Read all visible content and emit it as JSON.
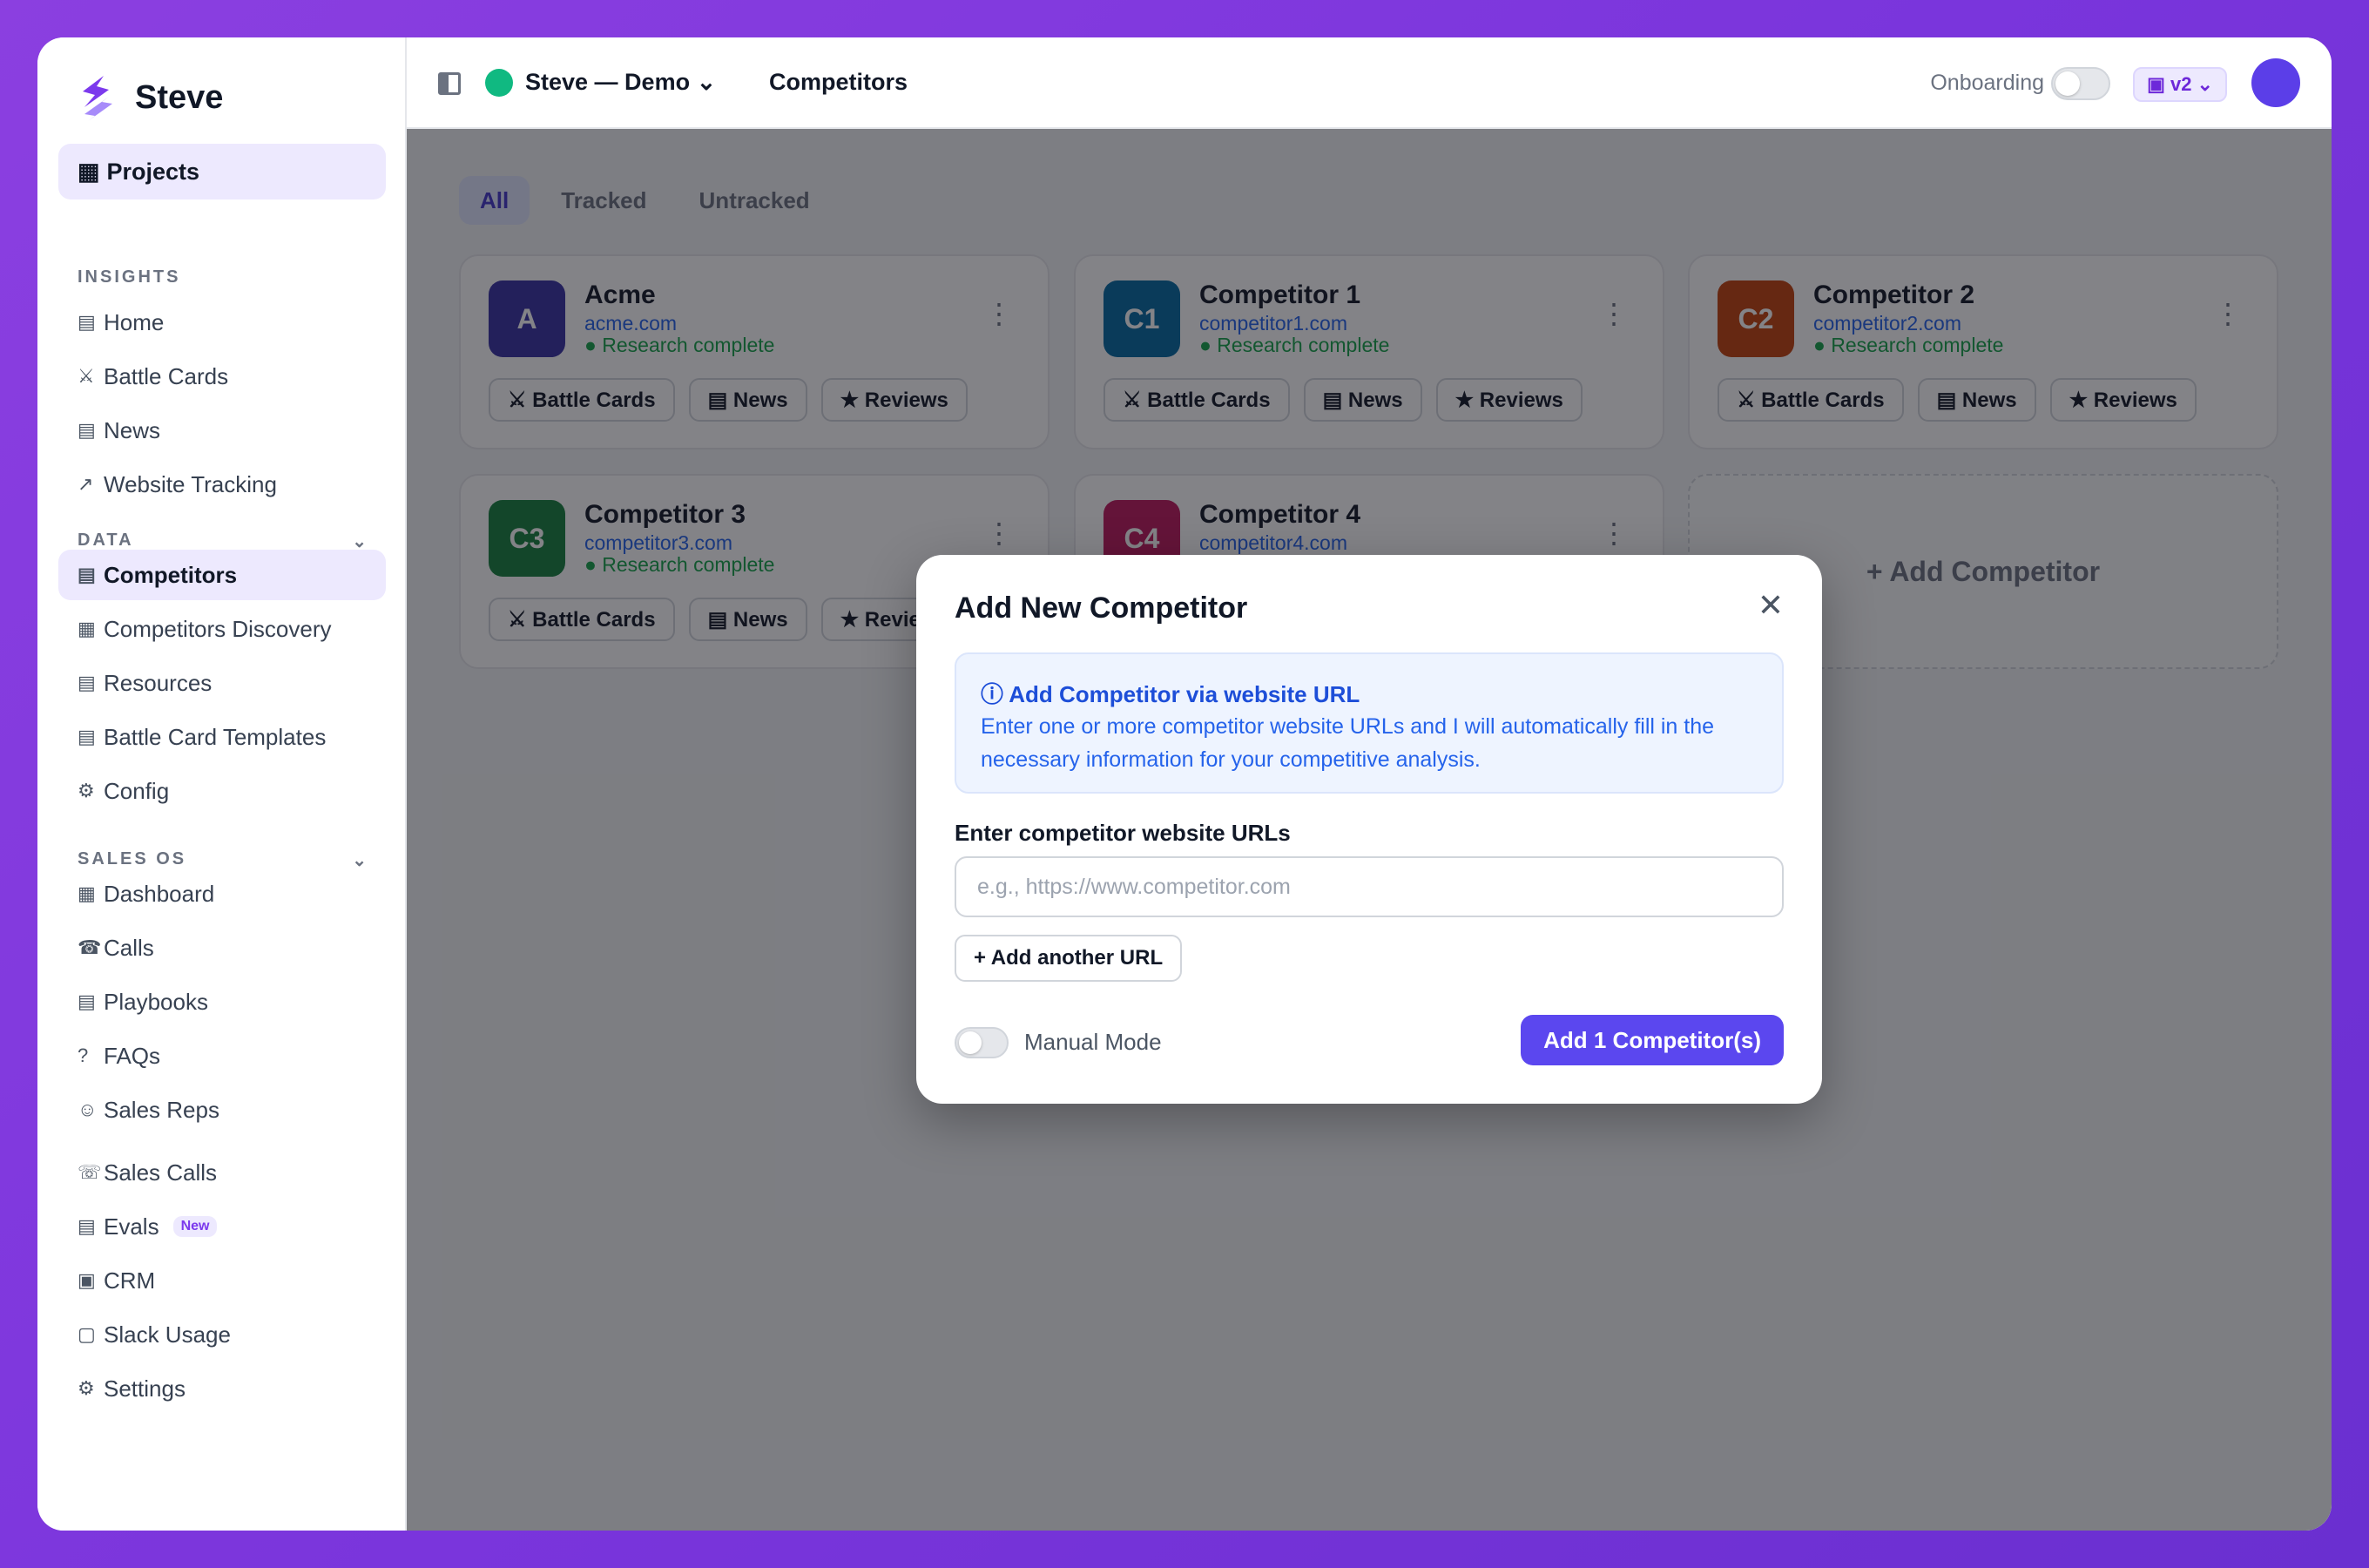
{
  "app": {
    "name": "Steve",
    "brand_color": "#7c3aed"
  },
  "sidebar": {
    "projects_label": "Projects",
    "sections": {
      "insights": "INSIGHTS",
      "data": "DATA",
      "sales_os": "SALES OS"
    },
    "insights_items": [
      {
        "icon": "▤",
        "label": "Home"
      },
      {
        "icon": "⚔",
        "label": "Battle Cards"
      },
      {
        "icon": "▤",
        "label": "News"
      },
      {
        "icon": "↗",
        "label": "Website Tracking"
      }
    ],
    "data_items": [
      {
        "icon": "▤",
        "label": "Competitors",
        "active": true
      },
      {
        "icon": "▦",
        "label": "Competitors Discovery"
      },
      {
        "icon": "▤",
        "label": "Resources"
      },
      {
        "icon": "▤",
        "label": "Battle Card Templates"
      },
      {
        "icon": "⚙",
        "label": "Config"
      }
    ],
    "sales_items": [
      {
        "icon": "▦",
        "label": "Dashboard"
      },
      {
        "icon": "☎",
        "label": "Calls"
      },
      {
        "icon": "▤",
        "label": "Playbooks"
      },
      {
        "icon": "?",
        "label": "FAQs"
      },
      {
        "icon": "☺",
        "label": "Sales Reps"
      }
    ],
    "other_items": [
      {
        "icon": "☏",
        "label": "Sales Calls"
      },
      {
        "icon": "▤",
        "label": "Evals",
        "badge": "New"
      },
      {
        "icon": "▣",
        "label": "CRM"
      },
      {
        "icon": "▢",
        "label": "Slack Usage"
      },
      {
        "icon": "⚙",
        "label": "Settings"
      }
    ]
  },
  "topbar": {
    "project": "Steve — Demo ⌄",
    "breadcrumb": "Competitors",
    "onboarding_label": "Onboarding",
    "version": "▣ v2 ⌄"
  },
  "main": {
    "tabs": [
      "All",
      "Tracked",
      "Untracked"
    ],
    "active_tab": "All",
    "chip_labels": {
      "battle_cards": "⚔ Battle Cards",
      "news": "▤ News",
      "reviews": "★ Reviews"
    },
    "competitors": [
      {
        "initials": "A",
        "name": "Acme",
        "domain": "acme.com",
        "status": "● Research complete",
        "color": "#3730a3"
      },
      {
        "initials": "C1",
        "name": "Competitor 1",
        "domain": "competitor1.com",
        "status": "● Research complete",
        "color": "#0369a1"
      },
      {
        "initials": "C2",
        "name": "Competitor 2",
        "domain": "competitor2.com",
        "status": "● Research complete",
        "color": "#c2410c"
      },
      {
        "initials": "C3",
        "name": "Competitor 3",
        "domain": "competitor3.com",
        "status": "● Research complete",
        "color": "#15803d"
      },
      {
        "initials": "C4",
        "name": "Competitor 4",
        "domain": "competitor4.com",
        "status": "",
        "color": "#be185d"
      }
    ],
    "add_card_label": "+ Add Competitor",
    "card_menu_icon": "⋮"
  },
  "modal": {
    "title": "Add New Competitor",
    "close_icon": "✕",
    "info_title": "ⓘ Add Competitor via website URL",
    "info_text": "Enter one or more competitor website URLs and I will automatically fill in the necessary information for your competitive analysis.",
    "url_label": "Enter competitor website URLs",
    "url_placeholder": "e.g., https://www.competitor.com",
    "url_value": "",
    "add_url_label": "+ Add another URL",
    "manual_mode_label": "Manual Mode",
    "submit_label": "Add 1 Competitor(s)"
  }
}
